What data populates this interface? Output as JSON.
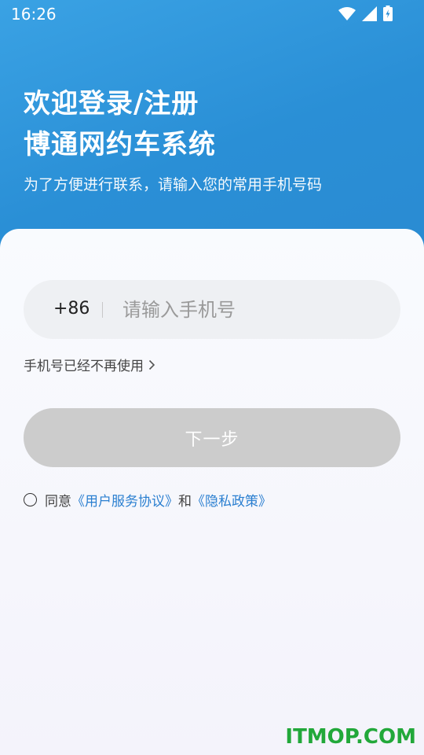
{
  "status_bar": {
    "time": "16:26"
  },
  "welcome": {
    "line1": "欢迎登录/注册",
    "line2": "博通网约车系统",
    "subtitle": "为了方便进行联系，请输入您的常用手机号码"
  },
  "phone_field": {
    "country_code": "+86",
    "placeholder": "请输入手机号",
    "value": ""
  },
  "no_longer_link": "手机号已经不再使用",
  "next_button": "下一步",
  "agreement": {
    "prefix": "同意",
    "user_agreement": "《用户服务协议》",
    "and": "和",
    "privacy_policy": "《隐私政策》"
  },
  "watermark": "ITMOP.COM",
  "colors": {
    "header_blue": "#2a8fd6",
    "link_blue": "#2a7fd0",
    "button_disabled": "#cccccc",
    "watermark_green": "#22a83a"
  }
}
